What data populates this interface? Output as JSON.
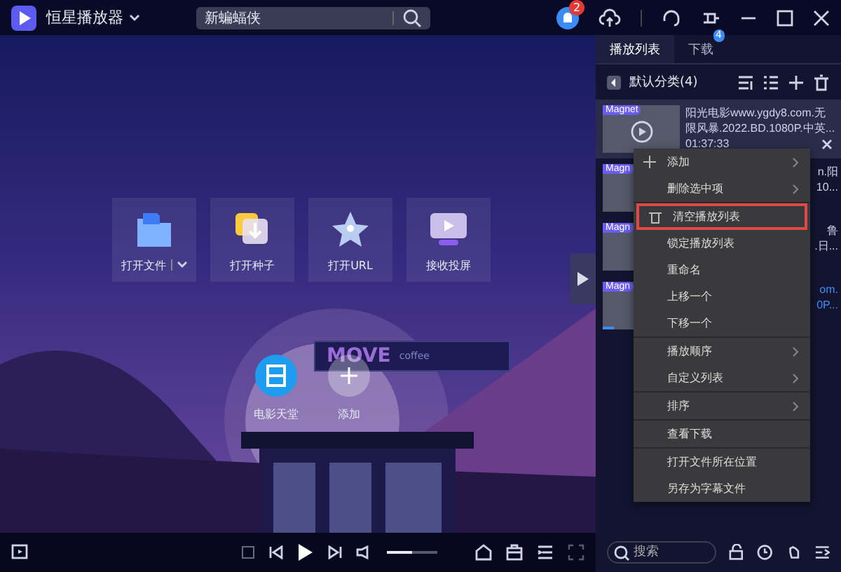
{
  "window": {
    "title": "恒星播放器",
    "search": {
      "value": "新蝙蝠侠"
    },
    "notification_count": "2"
  },
  "home": {
    "tiles": [
      {
        "label": "打开文件",
        "kind": "file",
        "dropdown": true
      },
      {
        "label": "打开种子",
        "kind": "torrent",
        "dropdown": false
      },
      {
        "label": "打开URL",
        "kind": "url",
        "dropdown": false
      },
      {
        "label": "接收投屏",
        "kind": "cast",
        "dropdown": false
      }
    ],
    "shortcuts": [
      {
        "label": "电影天堂",
        "kind": "app"
      },
      {
        "label": "添加",
        "kind": "add"
      }
    ],
    "sign": {
      "title": "MOVE",
      "subtitle": "coffee"
    }
  },
  "player": {
    "volume": {
      "level": 0.5
    }
  },
  "playlist": {
    "tabs": [
      {
        "label": "播放列表",
        "selected": true
      },
      {
        "label": "下载",
        "selected": false,
        "badge": "4"
      }
    ],
    "group": "默认分类(4)",
    "items": [
      {
        "badge": "Magnet",
        "lines": [
          "阳光电影www.ygdy8.com.无",
          "限风暴.2022.BD.1080P.中英...",
          "01:37:33"
        ],
        "selected": false
      },
      {
        "badge": "Magn",
        "lines": [
          "n.阳",
          "10..."
        ],
        "selected": false
      },
      {
        "badge": "Magn",
        "lines": [
          "鲁",
          ".日..."
        ],
        "selected": false
      },
      {
        "badge": "Magn",
        "lines": [
          "om.",
          "0P..."
        ],
        "selected": true
      }
    ],
    "search": {
      "placeholder": "搜索"
    }
  },
  "context_menu": {
    "sections": [
      [
        {
          "label": "添加",
          "kind": "add",
          "submenu": true,
          "highlighted": false
        },
        {
          "label": "删除选中项",
          "kind": "plain",
          "submenu": true,
          "highlighted": false
        }
      ],
      [
        {
          "label": "清空播放列表",
          "kind": "clear",
          "submenu": false,
          "highlighted": true
        },
        {
          "label": "锁定播放列表",
          "kind": "plain",
          "submenu": false,
          "highlighted": false
        },
        {
          "label": "重命名",
          "kind": "plain",
          "submenu": false,
          "highlighted": false
        },
        {
          "label": "上移一个",
          "kind": "plain",
          "submenu": false,
          "highlighted": false
        },
        {
          "label": "下移一个",
          "kind": "plain",
          "submenu": false,
          "highlighted": false
        }
      ],
      [
        {
          "label": "播放顺序",
          "kind": "plain",
          "submenu": true,
          "highlighted": false
        },
        {
          "label": "自定义列表",
          "kind": "plain",
          "submenu": true,
          "highlighted": false
        }
      ],
      [
        {
          "label": "排序",
          "kind": "plain",
          "submenu": true,
          "highlighted": false
        }
      ],
      [
        {
          "label": "查看下载",
          "kind": "plain",
          "submenu": false,
          "highlighted": false
        }
      ],
      [
        {
          "label": "打开文件所在位置",
          "kind": "plain",
          "submenu": false,
          "highlighted": false
        },
        {
          "label": "另存为字幕文件",
          "kind": "plain",
          "submenu": false,
          "highlighted": false
        }
      ]
    ]
  }
}
